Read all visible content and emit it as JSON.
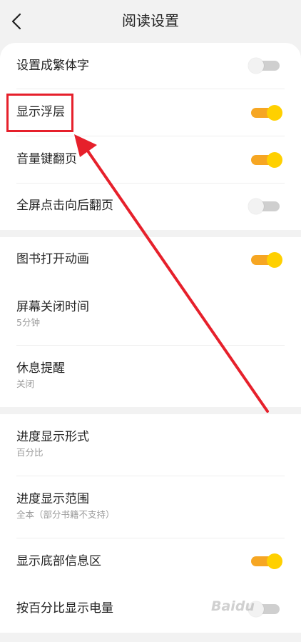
{
  "header": {
    "title": "阅读设置",
    "back_icon": "chevron-left-icon"
  },
  "section1": [
    {
      "label": "设置成繁体字",
      "toggle": "off"
    },
    {
      "label": "显示浮层",
      "toggle": "on"
    },
    {
      "label": "音量键翻页",
      "toggle": "on"
    },
    {
      "label": "全屏点击向后翻页",
      "toggle": "off"
    }
  ],
  "section2": [
    {
      "label": "图书打开动画",
      "toggle": "on"
    },
    {
      "label": "屏幕关闭时间",
      "value": "5分钟"
    },
    {
      "label": "休息提醒",
      "value": "关闭"
    }
  ],
  "section3": [
    {
      "label": "进度显示形式",
      "value": "百分比"
    },
    {
      "label": "进度显示范围",
      "value": "全本（部分书籍不支持）"
    },
    {
      "label": "显示底部信息区",
      "toggle": "on"
    },
    {
      "label": "按百分比显示电量",
      "toggle": "off"
    }
  ],
  "colors": {
    "accent": "#f6a623",
    "knob_on": "#ffd000",
    "annotation": "#e6202b"
  },
  "watermark": "Baidu"
}
